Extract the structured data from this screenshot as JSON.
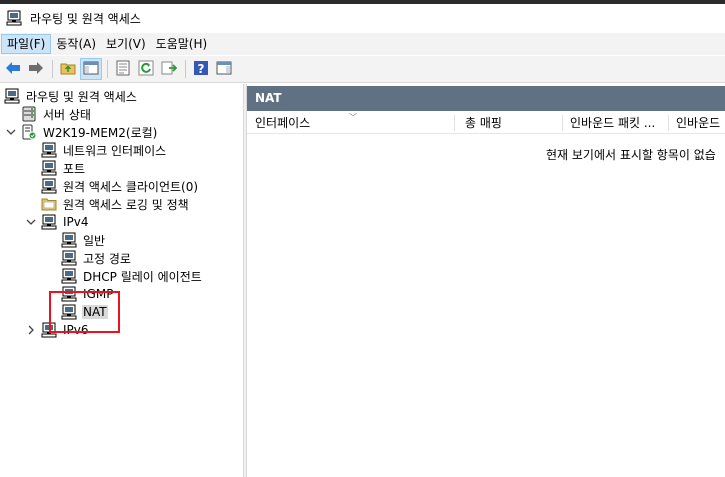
{
  "window": {
    "title": "라우팅 및 원격 액세스",
    "icon": "routing-server-icon"
  },
  "menubar": {
    "items": [
      {
        "label": "파일(F)"
      },
      {
        "label": "동작(A)"
      },
      {
        "label": "보기(V)"
      },
      {
        "label": "도움말(H)"
      }
    ]
  },
  "toolbar": {
    "buttons": [
      "back-arrow-icon",
      "forward-arrow-icon",
      "up-folder-icon",
      "show-hide-tree-icon",
      "properties-icon",
      "refresh-icon",
      "export-list-icon",
      "help-icon",
      "show-hide-action-pane-icon"
    ]
  },
  "tree": {
    "root": "라우팅 및 원격 액세스",
    "server_status": "서버 상태",
    "server": "W2K19-MEM2(로컬)",
    "network_interfaces": "네트워크 인터페이스",
    "ports": "포트",
    "remote_access_clients": "원격 액세스 클라이언트(0)",
    "remote_access_logging": "원격 액세스 로깅 및 정책",
    "ipv4": "IPv4",
    "general": "일반",
    "static_routes": "고정 경로",
    "dhcp_relay": "DHCP 릴레이 에이전트",
    "igmp": "IGMP",
    "nat": "NAT",
    "ipv6": "IPv6"
  },
  "details": {
    "header": "NAT",
    "columns": [
      "인터페이스",
      "총 매핑",
      "인바운드 패킷 ...",
      "인바운드"
    ],
    "empty_message": "현재 보기에서 표시할 항목이 없습"
  },
  "colors": {
    "pane_header_bg": "#5f7182",
    "highlight_border": "#e8141f",
    "selection_bg": "#d9d9d9"
  }
}
